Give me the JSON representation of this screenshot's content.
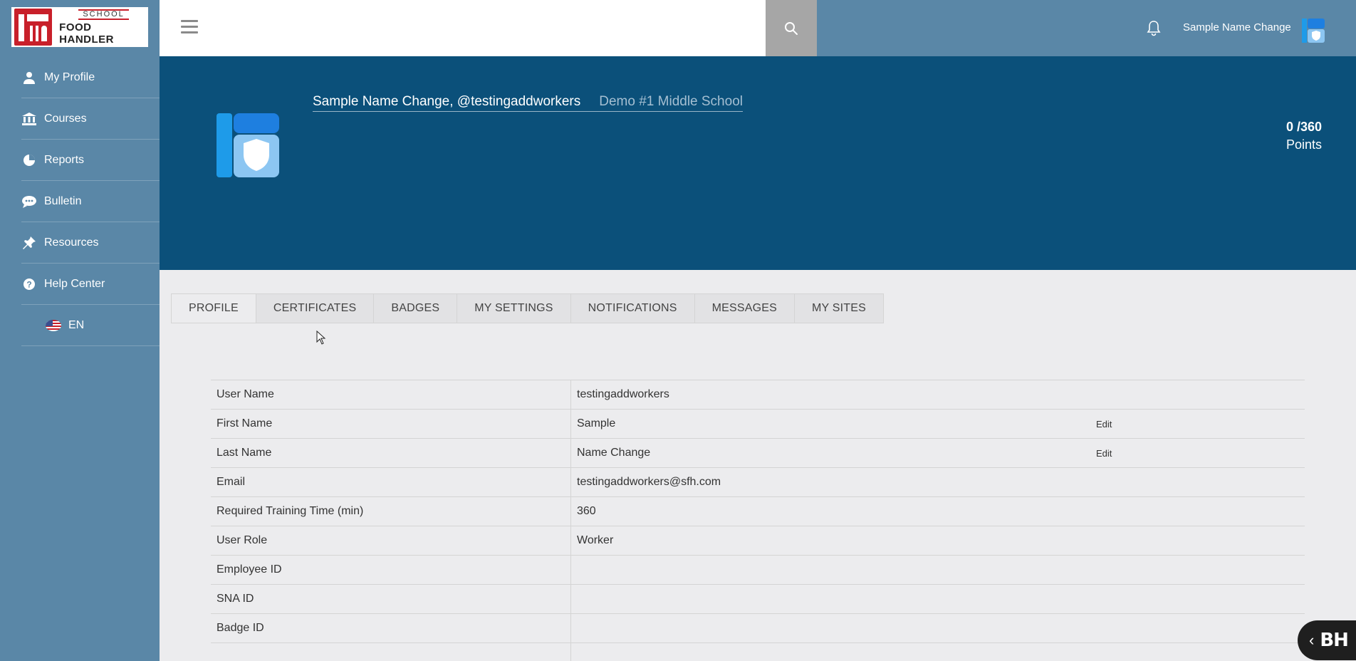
{
  "brand": {
    "logo_top": "SCHOOL",
    "logo_bottom": "FOOD HANDLER",
    "accent": "#c8202a"
  },
  "sidebar": {
    "items": [
      {
        "label": "My Profile",
        "icon": "user-icon"
      },
      {
        "label": "Courses",
        "icon": "bank-icon"
      },
      {
        "label": "Reports",
        "icon": "pie-chart-icon"
      },
      {
        "label": "Bulletin",
        "icon": "chat-icon"
      },
      {
        "label": "Resources",
        "icon": "pin-icon"
      },
      {
        "label": "Help Center",
        "icon": "question-circle-icon"
      }
    ],
    "language": "EN"
  },
  "header": {
    "user_name": "Sample Name Change"
  },
  "banner": {
    "name_handle": "Sample Name Change, @testingaddworkers",
    "school": "Demo #1 Middle School",
    "points_value": "0 /360",
    "points_label": "Points"
  },
  "tabs": [
    "PROFILE",
    "CERTIFICATES",
    "BADGES",
    "MY SETTINGS",
    "NOTIFICATIONS",
    "MESSAGES",
    "MY SITES"
  ],
  "profile": {
    "rows": [
      {
        "label": "User Name",
        "value": "testingaddworkers",
        "edit": ""
      },
      {
        "label": "First Name",
        "value": "Sample",
        "edit": "Edit"
      },
      {
        "label": "Last Name",
        "value": "Name Change",
        "edit": "Edit"
      },
      {
        "label": "Email",
        "value": "testingaddworkers@sfh.com",
        "edit": ""
      },
      {
        "label": "Required Training Time (min)",
        "value": "360",
        "edit": ""
      },
      {
        "label": "User Role",
        "value": "Worker",
        "edit": ""
      },
      {
        "label": "Employee ID",
        "value": "",
        "edit": ""
      },
      {
        "label": "SNA ID",
        "value": "",
        "edit": ""
      },
      {
        "label": "Badge ID",
        "value": "",
        "edit": ""
      }
    ]
  },
  "widget": {
    "label": "BH"
  }
}
